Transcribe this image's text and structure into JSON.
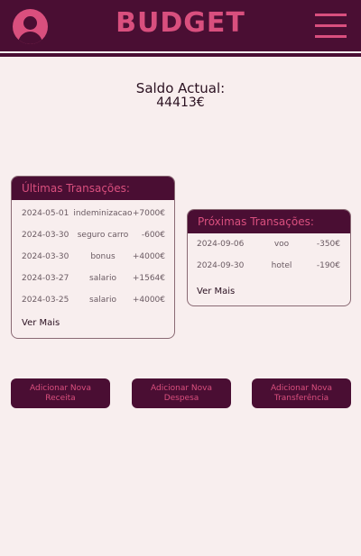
{
  "header": {
    "title": "BUDGET",
    "avatar_icon": "user-avatar-icon",
    "menu_icon": "hamburger-menu-icon"
  },
  "balance": {
    "label": "Saldo Actual:",
    "value": "44413€"
  },
  "last_transactions": {
    "title": "Últimas Transações:",
    "rows": [
      {
        "date": "2024-05-01",
        "description": "indeminizacao",
        "amount": "+7000€"
      },
      {
        "date": "2024-03-30",
        "description": "seguro carro",
        "amount": "-600€"
      },
      {
        "date": "2024-03-30",
        "description": "bonus",
        "amount": "+4000€"
      },
      {
        "date": "2024-03-27",
        "description": "salario",
        "amount": "+1564€"
      },
      {
        "date": "2024-03-25",
        "description": "salario",
        "amount": "+4000€"
      }
    ],
    "more": "Ver Mais"
  },
  "next_transactions": {
    "title": "Próximas Transações:",
    "rows": [
      {
        "date": "2024-09-06",
        "description": "voo",
        "amount": "-350€"
      },
      {
        "date": "2024-09-30",
        "description": "hotel",
        "amount": "-190€"
      }
    ],
    "more": "Ver Mais"
  },
  "actions": {
    "add_income": "Adicionar Nova Receita",
    "add_expense": "Adicionar Nova Despesa",
    "add_transfer": "Adicionar Nova Transferência"
  },
  "colors": {
    "primary": "#4a0e33",
    "accent": "#d94f7e",
    "background": "#f8eeee"
  }
}
